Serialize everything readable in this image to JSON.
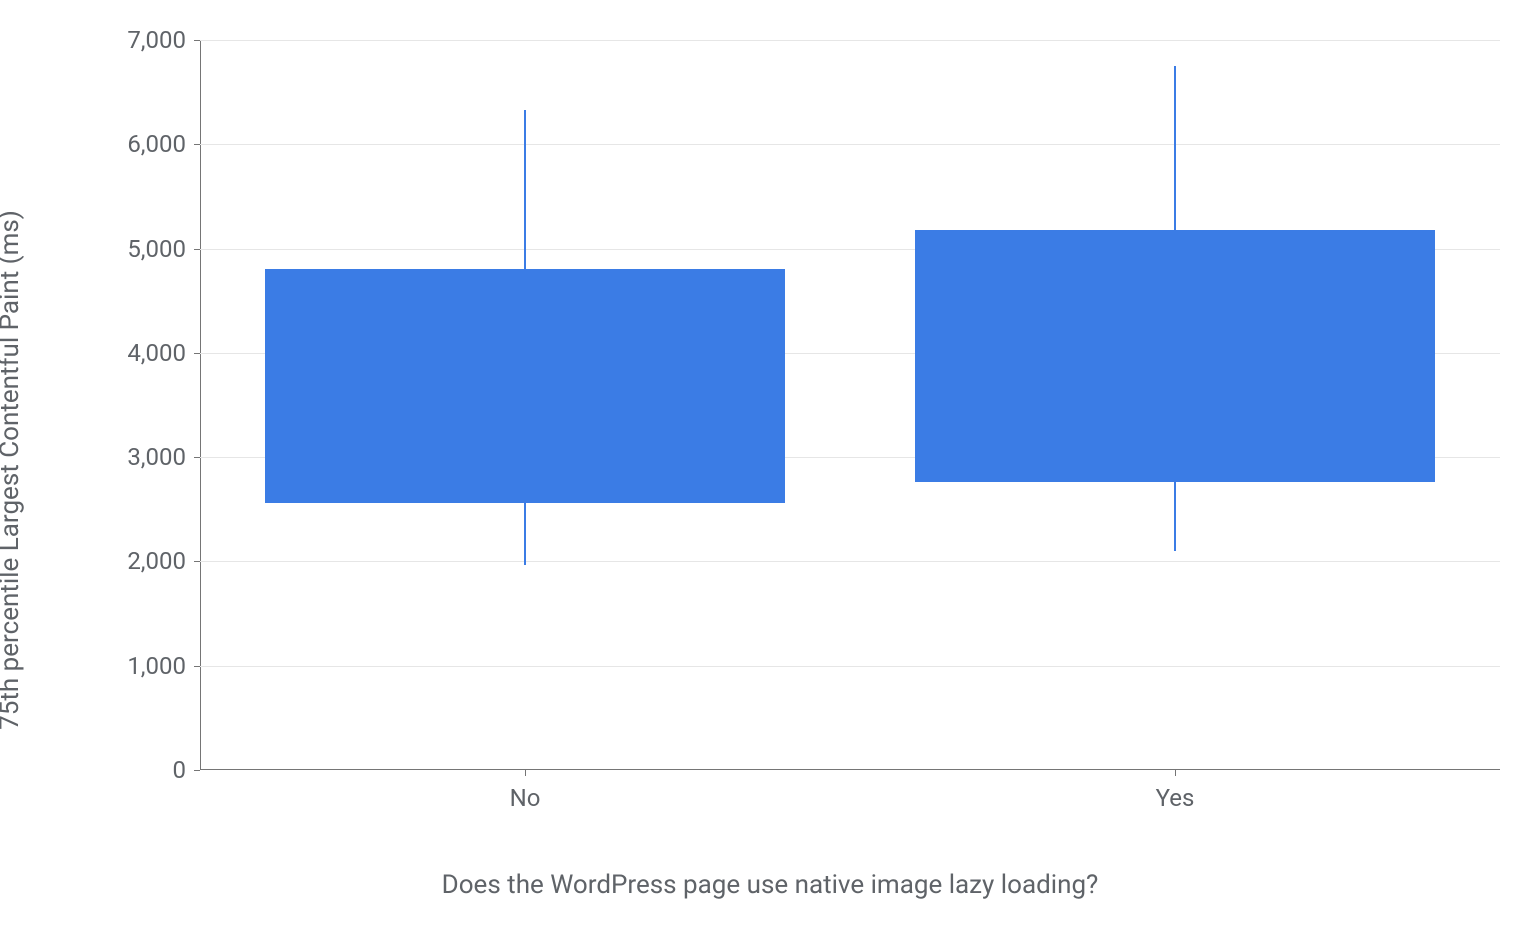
{
  "chart_data": {
    "type": "boxplot",
    "title": "",
    "xlabel": "Does the WordPress page use native image lazy loading?",
    "ylabel": "75th percentile Largest Contentful Paint (ms)",
    "ylim": [
      0,
      7000
    ],
    "yticks": [
      0,
      1000,
      2000,
      3000,
      4000,
      5000,
      6000,
      7000
    ],
    "ytick_labels": [
      "0",
      "1,000",
      "2,000",
      "3,000",
      "4,000",
      "5,000",
      "6,000",
      "7,000"
    ],
    "categories": [
      "No",
      "Yes"
    ],
    "series": [
      {
        "name": "No",
        "low": 1970,
        "q1": 2560,
        "q3": 4800,
        "high": 6330
      },
      {
        "name": "Yes",
        "low": 2100,
        "q1": 2760,
        "q3": 5180,
        "high": 6750
      }
    ],
    "colors": {
      "box_fill": "#3b7ce5",
      "whisker": "#3b7ce5"
    }
  },
  "layout": {
    "box_width_fraction": 0.4,
    "category_centers": [
      0.25,
      0.75
    ]
  }
}
